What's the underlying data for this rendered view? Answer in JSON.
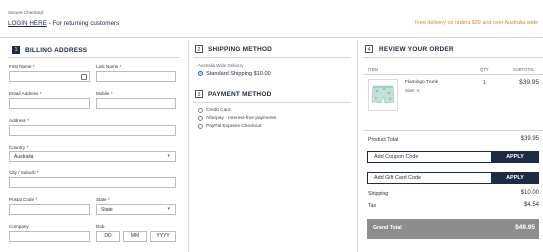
{
  "top": {
    "secure_checkout": "Secure Checkout",
    "login_link": "LOGIN HERE",
    "login_suffix": " - For returning customers",
    "delivery_banner": "Free delivery on orders $99 and over Australia wide"
  },
  "billing": {
    "step": "1",
    "title": "BILLING ADDRESS",
    "first_name_label": "First Name",
    "last_name_label": "Last Name",
    "email_label": "Email Address",
    "mobile_label": "Mobile",
    "address_label": "Address",
    "country_label": "Country",
    "country_value": "Australia",
    "city_label": "City / Suburb",
    "postal_label": "Postal Code",
    "state_label": "State",
    "state_value": "State",
    "company_label": "Company",
    "dob_label": "Dob",
    "dob_dd": "DD",
    "dob_mm": "MM",
    "dob_yyyy": "YYYY",
    "required_mark": "*"
  },
  "shipping": {
    "step": "2",
    "title": "SHIPPING METHOD",
    "group_label": "Australia Wide Delivery",
    "option": "Standard Shipping $10.00"
  },
  "payment": {
    "step": "3",
    "title": "PAYMENT METHOD",
    "options": [
      "Credit Card",
      "Afterpay - Interest-free payments",
      "PayPal Express Checkout"
    ]
  },
  "review": {
    "step": "4",
    "title": "REVIEW YOUR ORDER",
    "col_item": "ITEM",
    "col_qty": "QTY",
    "col_subtotal": "SUBTOTAL",
    "product_name": "Flamingo Trunk",
    "product_size": "Size: 4",
    "product_qty": "1",
    "product_price": "$39.95",
    "product_total_label": "Product Total",
    "product_total_value": "$39.95",
    "coupon_label": "Add Coupon Code",
    "gift_label": "Add Gift Card Code",
    "apply_label": "APPLY",
    "shipping_label": "Shipping",
    "shipping_value": "$10.00",
    "tax_label": "Tax",
    "tax_value": "$4.54",
    "grand_total_label": "Grand Total",
    "grand_total_value": "$49.95"
  },
  "colors": {
    "navy": "#1f2a44",
    "banner_orange": "#c98a4a",
    "grand_total_bg": "#8d8d8d"
  }
}
